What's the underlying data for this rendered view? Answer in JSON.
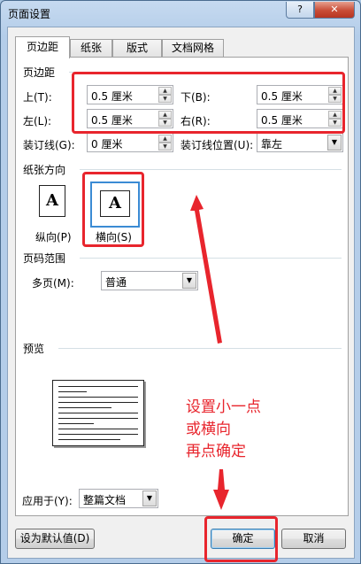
{
  "window": {
    "title": "页面设置",
    "help_glyph": "?",
    "close_glyph": "✕"
  },
  "tabs": [
    {
      "label": "页边距",
      "active": true
    },
    {
      "label": "纸张",
      "active": false
    },
    {
      "label": "版式",
      "active": false
    },
    {
      "label": "文档网格",
      "active": false
    }
  ],
  "margins": {
    "section_title": "页边距",
    "top_label": "上(T):",
    "top_value": "0.5 厘米",
    "bottom_label": "下(B):",
    "bottom_value": "0.5 厘米",
    "left_label": "左(L):",
    "left_value": "0.5 厘米",
    "right_label": "右(R):",
    "right_value": "0.5 厘米",
    "gutter_label": "装订线(G):",
    "gutter_value": "0 厘米",
    "gutter_pos_label": "装订线位置(U):",
    "gutter_pos_value": "靠左"
  },
  "orientation": {
    "section_title": "纸张方向",
    "glyph": "A",
    "portrait_label": "纵向(P)",
    "landscape_label": "横向(S)",
    "selected": "landscape"
  },
  "pages": {
    "section_title": "页码范围",
    "multi_label": "多页(M):",
    "multi_value": "普通"
  },
  "preview": {
    "section_title": "预览"
  },
  "apply": {
    "label": "应用于(Y):",
    "value": "整篇文档"
  },
  "buttons": {
    "set_default": "设为默认值(D)",
    "ok": "确定",
    "cancel": "取消"
  },
  "annotation": {
    "lines": [
      "设置小一点",
      "或横向",
      "再点确定"
    ],
    "color": "#e8252d"
  },
  "colors": {
    "accent": "#3b8bd4",
    "annotation_red": "#e8252d"
  }
}
